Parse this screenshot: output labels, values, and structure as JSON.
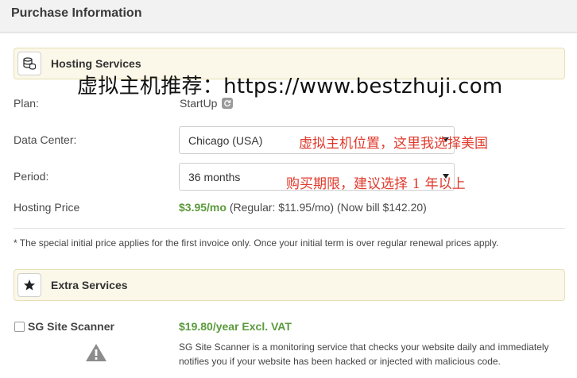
{
  "header": {
    "title": "Purchase Information"
  },
  "hosting_section": {
    "title": "Hosting Services",
    "icon": "database-coins-icon"
  },
  "watermark": "虚拟主机推荐：https://www.bestzhuji.com",
  "plan": {
    "label": "Plan:",
    "value": "StartUp",
    "icon": "refresh-icon"
  },
  "data_center": {
    "label": "Data Center:",
    "selected": "Chicago (USA)",
    "annotation": "虚拟主机位置，这里我选择美国"
  },
  "period": {
    "label": "Period:",
    "selected": "36 months",
    "annotation": "购买期限，建议选择 1 年以上"
  },
  "hosting_price": {
    "label": "Hosting Price",
    "price": "$3.95/mo",
    "regular": "(Regular: $11.95/mo)",
    "now_bill": "(Now bill $142.20)"
  },
  "note": "* The special initial price applies for the first invoice only. Once your initial term is over regular renewal prices apply.",
  "extra_section": {
    "title": "Extra Services",
    "icon": "star-icon"
  },
  "sg_scanner": {
    "label": "SG Site Scanner",
    "price": "$19.80/year Excl. VAT",
    "description": "SG Site Scanner is a monitoring service that checks your website daily and immediately notifies you if your website has been hacked or injected with malicious code.",
    "checked": false,
    "icon": "warning-icon"
  },
  "colors": {
    "price_green": "#5b9a3c",
    "annotation_red": "#e0392b",
    "section_bg": "#fbf8e9"
  }
}
